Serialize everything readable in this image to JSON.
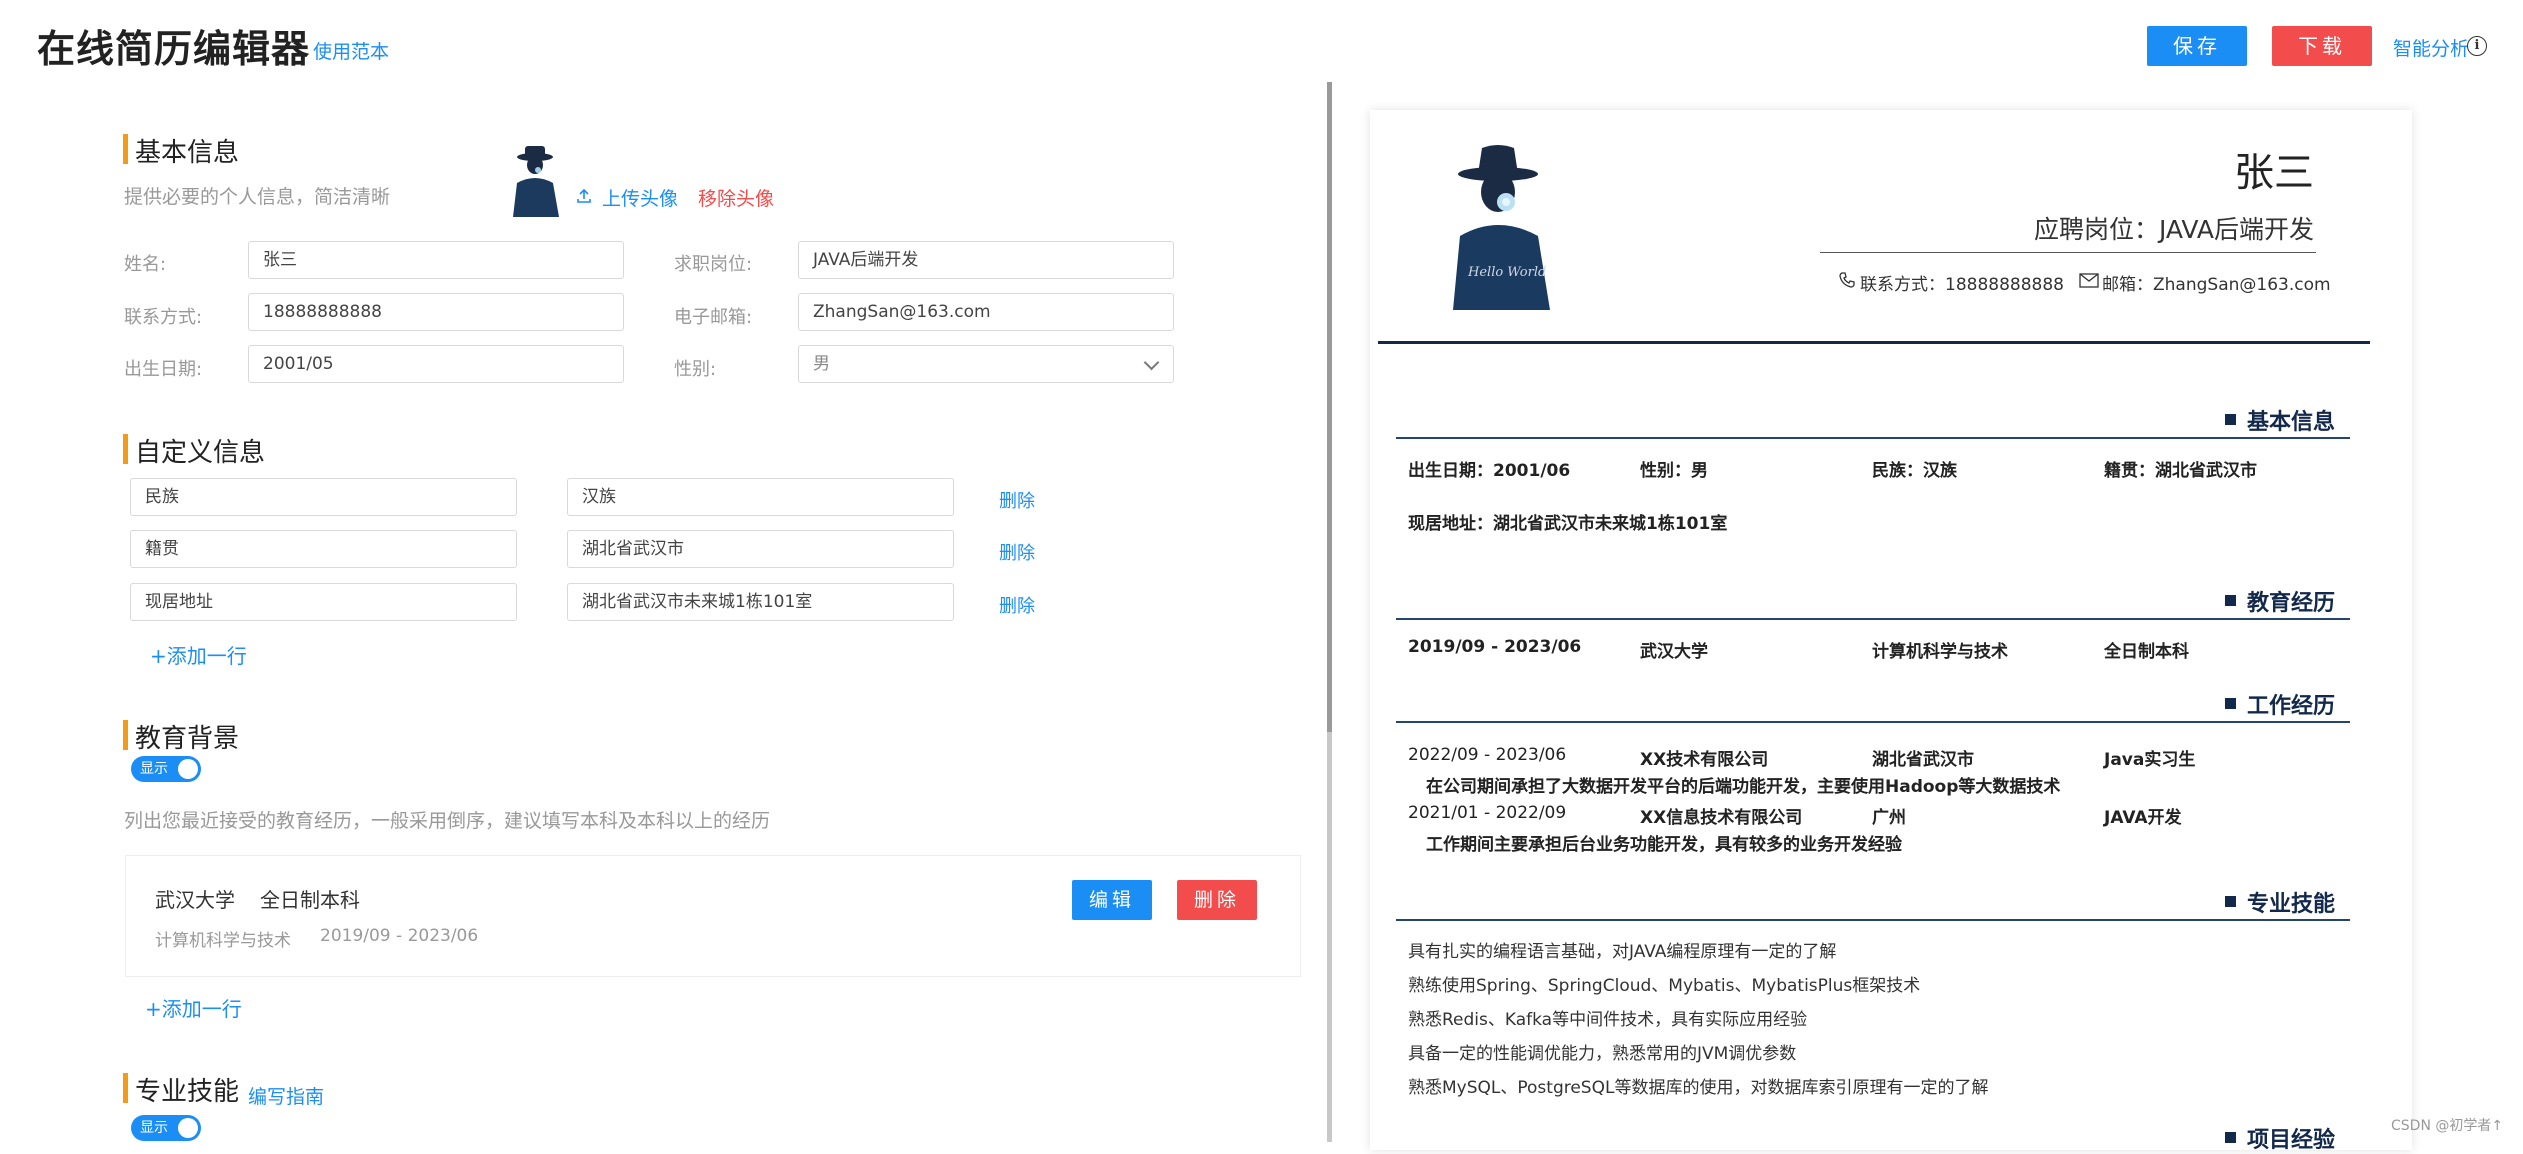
{
  "header": {
    "title": "在线简历编辑器",
    "use_sample": "使用范本",
    "save": "保存",
    "download": "下载",
    "smart_analysis": "智能分析",
    "info_glyph": "i"
  },
  "basic": {
    "title": "基本信息",
    "desc": "提供必要的个人信息，简洁清晰",
    "upload_avatar": "上传头像",
    "remove_avatar": "移除头像",
    "fields": {
      "name_label": "姓名:",
      "name_value": "张三",
      "job_label": "求职岗位:",
      "job_value": "JAVA后端开发",
      "contact_label": "联系方式:",
      "contact_value": "18888888888",
      "email_label": "电子邮箱:",
      "email_value": "ZhangSan@163.com",
      "birth_label": "出生日期:",
      "birth_value": "2001/05",
      "gender_label": "性别:",
      "gender_value": "男"
    }
  },
  "custom": {
    "title": "自定义信息",
    "rows": [
      {
        "key": "民族",
        "value": "汉族",
        "delete": "删除"
      },
      {
        "key": "籍贯",
        "value": "湖北省武汉市",
        "delete": "删除"
      },
      {
        "key": "现居地址",
        "value": "湖北省武汉市未来城1栋101室",
        "delete": "删除"
      }
    ],
    "add_row": "+添加一行"
  },
  "education": {
    "title": "教育背景",
    "toggle_label": "显示",
    "desc": "列出您最近接受的教育经历，一般采用倒序，建议填写本科及本科以上的经历",
    "card": {
      "school": "武汉大学",
      "degree": "全日制本科",
      "major": "计算机科学与技术",
      "period": "2019/09 - 2023/06",
      "edit": "编辑",
      "delete": "删除"
    },
    "add_row": "+添加一行"
  },
  "skills": {
    "title": "专业技能",
    "guide": "编写指南",
    "toggle_label": "显示"
  },
  "preview": {
    "name": "张三",
    "position": "应聘岗位：JAVA后端开发",
    "contact": "联系方式：18888888888",
    "email": "邮箱：ZhangSan@163.com",
    "avatar_text": "Hello World",
    "basic_title": "基本信息",
    "basic_items": [
      "出生日期：2001/06",
      "性别：男",
      "民族：汉族",
      "籍贯：湖北省武汉市"
    ],
    "address": "现居地址：湖北省武汉市未来城1栋101室",
    "edu_title": "教育经历",
    "edu_row": [
      "2019/09 - 2023/06",
      "武汉大学",
      "计算机科学与技术",
      "全日制本科"
    ],
    "work_title": "工作经历",
    "work": [
      {
        "period": "2022/09 - 2023/06",
        "company": "XX技术有限公司",
        "city": "湖北省武汉市",
        "role": "Java实习生",
        "desc": "在公司期间承担了大数据开发平台的后端功能开发，主要使用Hadoop等大数据技术"
      },
      {
        "period": "2021/01 - 2022/09",
        "company": "XX信息技术有限公司",
        "city": "广州",
        "role": "JAVA开发",
        "desc": "工作期间主要承担后台业务功能开发，具有较多的业务开发经验"
      }
    ],
    "skills_title": "专业技能",
    "skills": [
      "具有扎实的编程语言基础，对JAVA编程原理有一定的了解",
      "熟练使用Spring、SpringCloud、Mybatis、MybatisPlus框架技术",
      "熟悉Redis、Kafka等中间件技术，具有实际应用经验",
      "具备一定的性能调优能力，熟悉常用的JVM调优参数",
      "熟悉MySQL、PostgreSQL等数据库的使用，对数据库索引原理有一定的了解"
    ],
    "project_title": "项目经验"
  },
  "watermark": "CSDN @初学者↑",
  "colors": {
    "accent": "#1b8ef5",
    "danger": "#f24c4c",
    "section_bar": "#f39b16",
    "preview_navy": "#13294b"
  },
  "icons": [
    "upload-icon",
    "info-icon",
    "phone-icon",
    "mail-icon",
    "chevron-down-icon",
    "avatar"
  ]
}
